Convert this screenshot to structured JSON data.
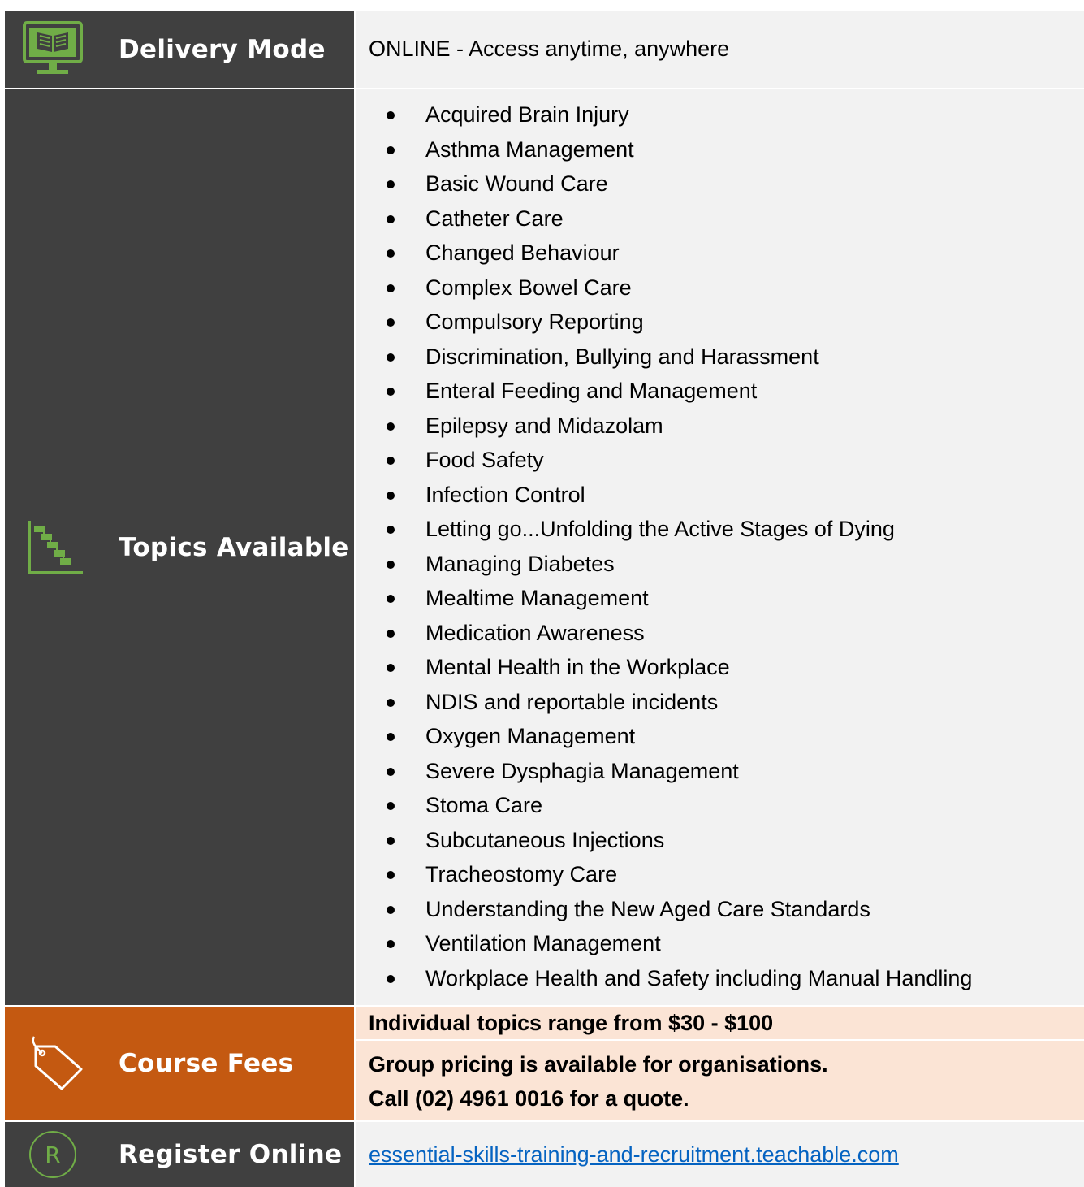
{
  "rows": {
    "delivery": {
      "label": "Delivery Mode",
      "value": "ONLINE - Access anytime, anywhere",
      "icon": "monitor-book-icon"
    },
    "topics": {
      "label": "Topics Available",
      "icon": "staircase-chart-icon",
      "items": [
        "Acquired Brain Injury",
        "Asthma Management",
        "Basic Wound Care",
        "Catheter Care",
        "Changed Behaviour",
        "Complex Bowel Care",
        "Compulsory Reporting",
        "Discrimination, Bullying and Harassment",
        "Enteral Feeding and Management",
        "Epilepsy and Midazolam",
        "Food Safety",
        "Infection Control",
        "Letting go...Unfolding the Active Stages of Dying",
        "Managing Diabetes",
        "Mealtime Management",
        "Medication Awareness",
        "Mental Health in the Workplace",
        "NDIS and reportable incidents",
        "Oxygen Management",
        "Severe Dysphagia Management",
        "Stoma Care",
        "Subcutaneous Injections",
        "Tracheostomy Care",
        "Understanding the New Aged Care Standards",
        "Ventilation Management",
        "Workplace Health and Safety including Manual Handling"
      ]
    },
    "fees": {
      "label": "Course Fees",
      "icon": "price-tag-icon",
      "line1": "Individual topics range from $30 - $100",
      "line2": "Group pricing is available for organisations.",
      "line3": "Call (02) 4961 0016 for a quote."
    },
    "register": {
      "label": "Register Online",
      "icon": "registered-icon",
      "link": "essential-skills-training-and-recruitment.teachable.com"
    }
  },
  "colors": {
    "label_bg": "#404040",
    "fees_label_bg": "#c45911",
    "icon_green": "#70ad47",
    "value_bg": "#f2f2f2",
    "fees_value_bg": "#fbe4d5",
    "link": "#0563c1"
  }
}
